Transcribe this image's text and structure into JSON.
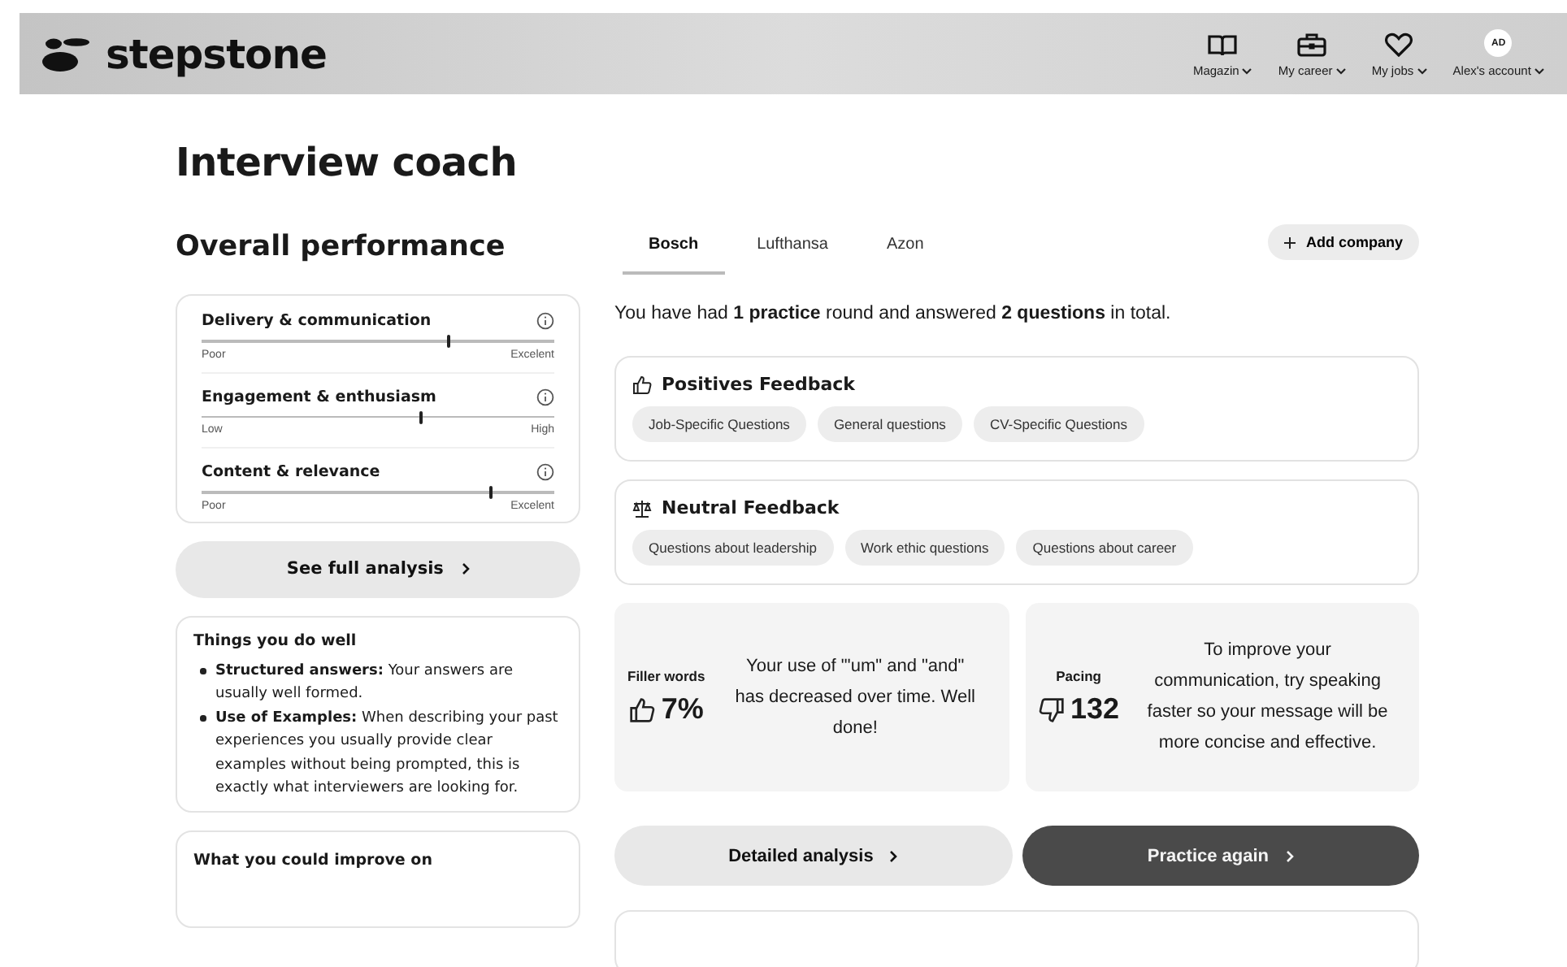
{
  "header": {
    "logo": "stepstone",
    "nav": [
      {
        "kind": "book",
        "label": "Magazin"
      },
      {
        "kind": "briefcase",
        "label": "My career"
      },
      {
        "kind": "heart",
        "label": "My jobs"
      },
      {
        "kind": "avatar",
        "label": "Alex's account",
        "initials": "AD"
      }
    ]
  },
  "title": "Interview coach",
  "performance": {
    "heading": "Overall performance",
    "metrics": [
      {
        "name": "Delivery & communication",
        "level": 0.7,
        "low": "Poor",
        "high": "Excelent"
      },
      {
        "name": "Engagement & enthusiasm",
        "level": 0.62,
        "low": "Low",
        "high": "High"
      },
      {
        "name": "Content & relevance",
        "level": 0.82,
        "low": "Poor",
        "high": "Excelent"
      }
    ],
    "button": "See full analysis"
  },
  "strengths": {
    "heading": "Things you do well",
    "items": [
      {
        "title": "Structured answers:",
        "text": "Your answers are usually well formed."
      },
      {
        "title": "Use of Examples:",
        "text": "When describing your past experiences you usually provide clear examples without being prompted, this is exactly what interviewers are looking for."
      }
    ]
  },
  "improve": {
    "heading": "What you could improve on"
  },
  "tabs": [
    {
      "label": "Bosch",
      "selected": true
    },
    {
      "label": "Lufthansa",
      "selected": false
    },
    {
      "label": "Azon",
      "selected": false
    }
  ],
  "add_company": "Add company",
  "summary": "You have had **1 practice** round and answered **2 questions** in total.",
  "feedback": [
    {
      "kind": "positive",
      "title": "Positives Feedback",
      "tags": [
        "Job-Specific Questions",
        "General questions",
        "CV-Specific Questions"
      ]
    },
    {
      "kind": "neutral",
      "title": "Neutral Feedback",
      "tags": [
        "Questions about leadership",
        "Work ethic questions",
        "Questions about career"
      ]
    }
  ],
  "stats": [
    {
      "label": "Filler words",
      "kind": "good",
      "value": "7%",
      "text": "Your use of \"'um\" and \"and\" has decreased over time. Well done!"
    },
    {
      "label": "Pacing",
      "kind": "bad",
      "value": "132",
      "text": "To improve your communication, try speaking faster so your message will be more concise and effective."
    }
  ],
  "actions": [
    {
      "kind": "secondary",
      "label": "Detailed analysis"
    },
    {
      "kind": "primary",
      "label": "Practice again"
    }
  ]
}
